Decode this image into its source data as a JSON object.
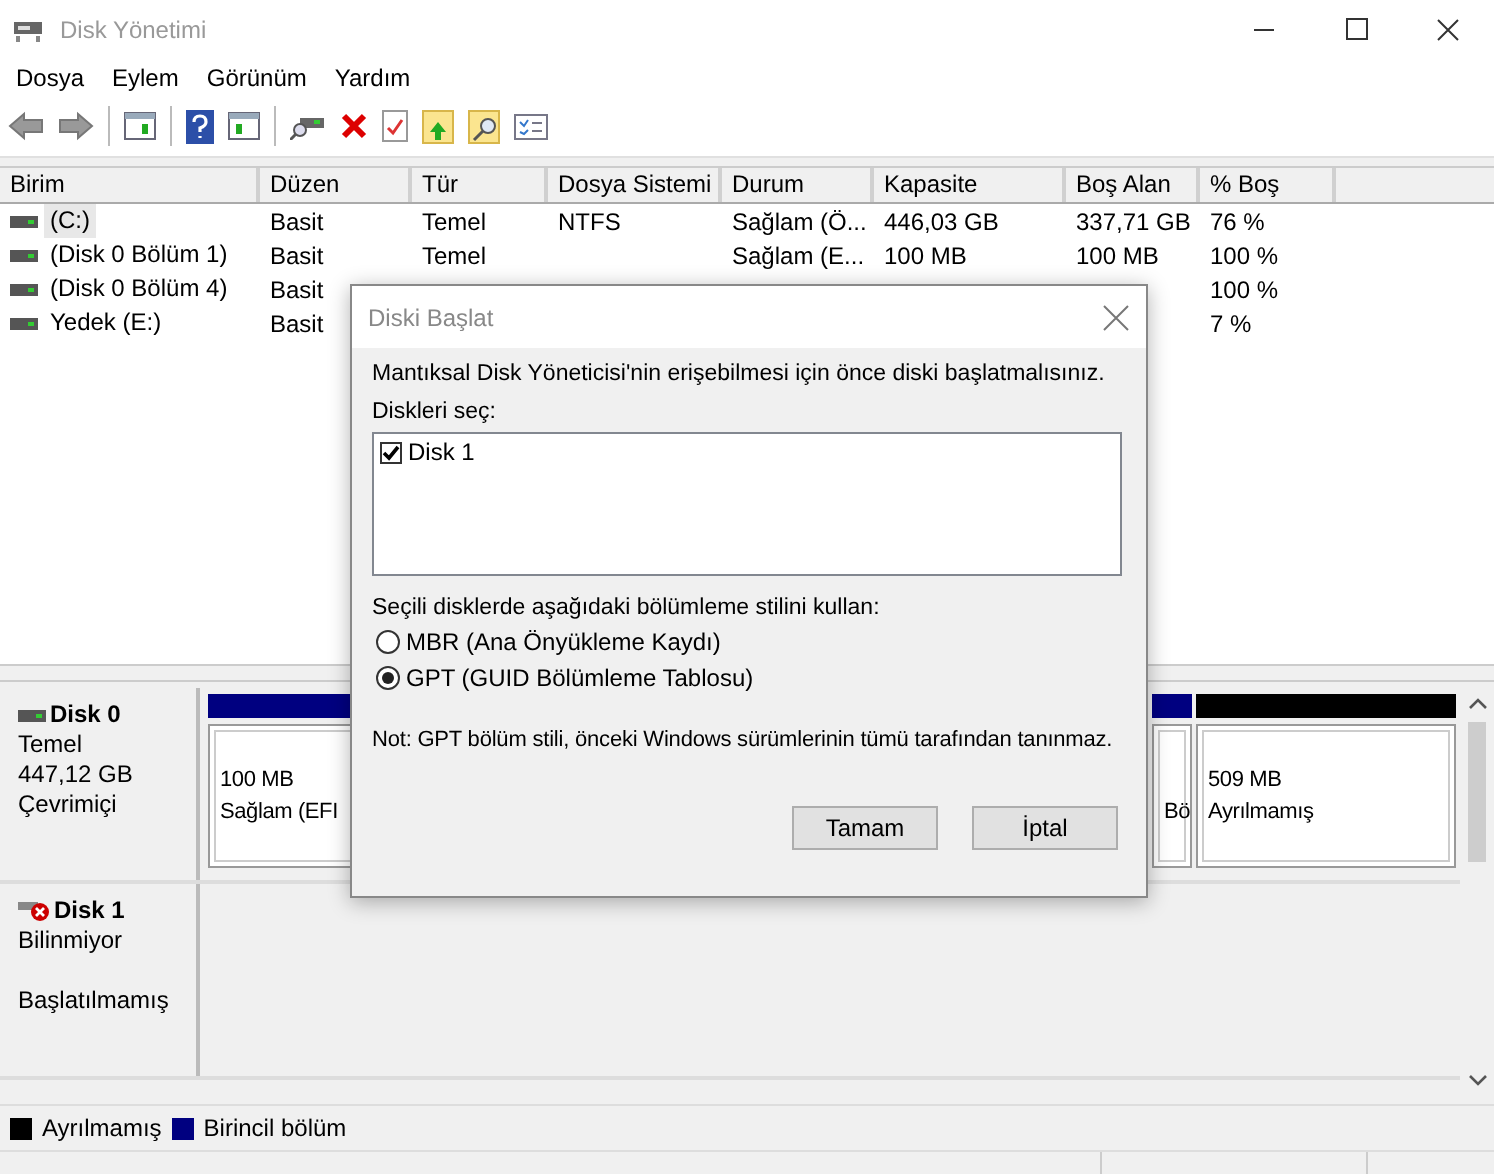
{
  "window": {
    "title": "Disk Yönetimi"
  },
  "menu": [
    "Dosya",
    "Eylem",
    "Görünüm",
    "Yardım"
  ],
  "volumes": {
    "columns": [
      "Birim",
      "Düzen",
      "Tür",
      "Dosya Sistemi",
      "Durum",
      "Kapasite",
      "Boş Alan",
      "% Boş"
    ],
    "rows": [
      {
        "selected": true,
        "cells": [
          "(C:)",
          "Basit",
          "Temel",
          "NTFS",
          "Sağlam (Ö...",
          "446,03 GB",
          "337,71 GB",
          "76 %"
        ]
      },
      {
        "selected": false,
        "cells": [
          "(Disk 0 Bölüm 1)",
          "Basit",
          "Temel",
          null,
          "Sağlam (E...",
          "100 MB",
          "100 MB",
          "100 %"
        ]
      },
      {
        "selected": false,
        "cells": [
          "(Disk 0 Bölüm 4)",
          "Basit",
          null,
          null,
          null,
          null,
          null,
          "100 %"
        ]
      },
      {
        "selected": false,
        "cells": [
          "Yedek (E:)",
          "Basit",
          null,
          null,
          null,
          null,
          null,
          "7 %"
        ]
      }
    ]
  },
  "disks": [
    {
      "kind": "online",
      "name": "Disk 0",
      "lines": [
        "Temel",
        "447,12 GB",
        "Çevrimiçi"
      ],
      "partitions": [
        {
          "kind": "primary",
          "size": "100 MB",
          "status": "Sağlam (EFI"
        },
        {
          "kind": "primary",
          "status": "Bö"
        },
        {
          "kind": "unallocated",
          "size": "509 MB",
          "status": "Ayrılmamış"
        }
      ]
    },
    {
      "kind": "not_initialized",
      "name": "Disk 1",
      "lines": [
        "Bilinmiyor",
        "Başlatılmamış"
      ]
    }
  ],
  "legend": [
    {
      "label": "Ayrılmamış",
      "color": "#000000"
    },
    {
      "label": "Birincil bölüm",
      "color": "#000080"
    }
  ],
  "dialog": {
    "title": "Diski Başlat",
    "message": "Mantıksal Disk Yöneticisi'nin erişebilmesi için önce diski başlatmalısınız.",
    "list_label": "Diskleri seç:",
    "disks": [
      {
        "label": "Disk 1",
        "checked": true
      }
    ],
    "style_label": "Seçili disklerde aşağıdaki bölümleme stilini kullan:",
    "options": [
      {
        "label": "MBR (Ana Önyükleme Kaydı)",
        "selected": false
      },
      {
        "label": "GPT (GUID Bölümleme Tablosu)",
        "selected": true
      }
    ],
    "note": "Not: GPT bölüm stili, önceki Windows sürümlerinin tümü tarafından tanınmaz.",
    "buttons": [
      "Tamam",
      "İptal"
    ]
  }
}
